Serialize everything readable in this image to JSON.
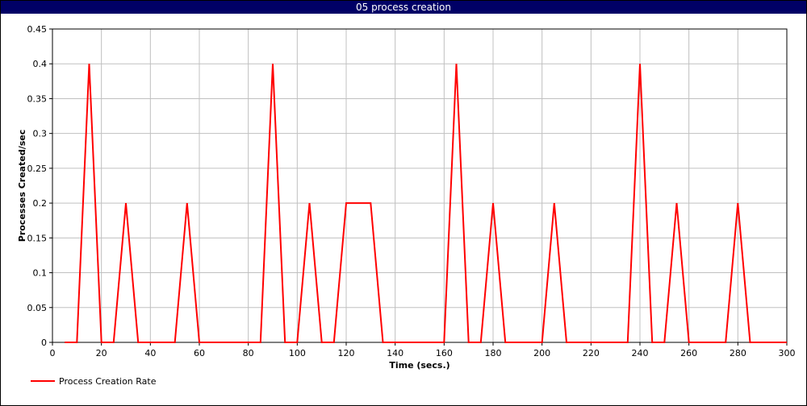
{
  "window": {
    "title": "05 process creation"
  },
  "chart_data": {
    "type": "line",
    "title": "05 process creation",
    "xlabel": "Time (secs.)",
    "ylabel": "Processes Created/sec",
    "xlim": [
      0,
      300
    ],
    "ylim": [
      0,
      0.45
    ],
    "xticks": [
      0,
      20,
      40,
      60,
      80,
      100,
      120,
      140,
      160,
      180,
      200,
      220,
      240,
      260,
      280,
      300
    ],
    "yticks": [
      0,
      0.05,
      0.1,
      0.15,
      0.2,
      0.25,
      0.3,
      0.35,
      0.4,
      0.45
    ],
    "ytick_labels": [
      "0",
      "0.05",
      "0.1",
      "0.15",
      "0.2",
      "0.25",
      "0.3",
      "0.35",
      "0.4",
      "0.45"
    ],
    "grid": true,
    "legend_position": "bottom-left",
    "colors": {
      "series": "#ff0000",
      "grid": "#c0c0c0",
      "titlebar": "#000066"
    },
    "series": [
      {
        "name": "Process Creation Rate",
        "x": [
          5,
          10,
          15,
          20,
          25,
          30,
          35,
          40,
          45,
          50,
          55,
          60,
          65,
          70,
          75,
          80,
          85,
          90,
          95,
          100,
          105,
          110,
          115,
          120,
          125,
          130,
          135,
          140,
          145,
          150,
          155,
          160,
          165,
          170,
          175,
          180,
          185,
          190,
          195,
          200,
          205,
          210,
          215,
          220,
          225,
          230,
          235,
          240,
          245,
          250,
          255,
          260,
          265,
          270,
          275,
          280,
          285,
          290,
          295,
          300
        ],
        "y": [
          0,
          0,
          0.4,
          0,
          0,
          0.2,
          0,
          0,
          0,
          0,
          0.2,
          0,
          0,
          0,
          0,
          0,
          0,
          0.4,
          0,
          0,
          0.2,
          0,
          0,
          0.2,
          0.2,
          0.2,
          0,
          0,
          0,
          0,
          0,
          0,
          0.4,
          0,
          0,
          0.2,
          0,
          0,
          0,
          0,
          0.2,
          0,
          0,
          0,
          0,
          0,
          0,
          0.4,
          0,
          0,
          0.2,
          0,
          0,
          0,
          0,
          0.2,
          0,
          0,
          0,
          0
        ]
      }
    ]
  }
}
